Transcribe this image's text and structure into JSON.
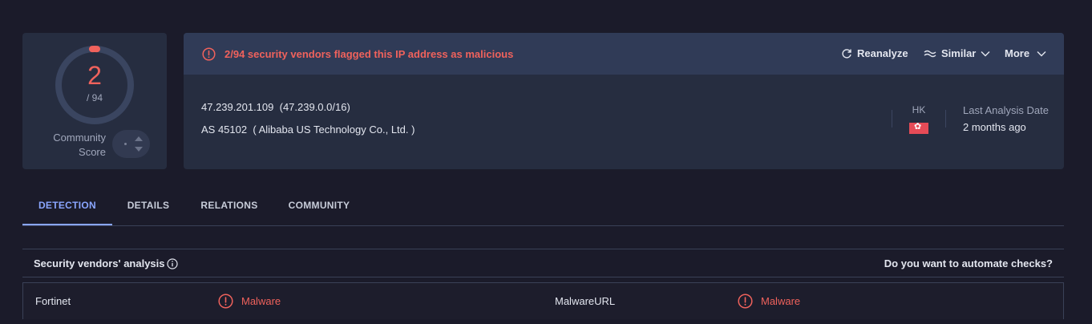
{
  "score": {
    "detections": "2",
    "total": "/ 94",
    "community_label_line1": "Community",
    "community_label_line2": "Score",
    "detection_fraction": 0.0213
  },
  "alert": {
    "text": "2/94 security vendors flagged this IP address as malicious"
  },
  "actions": {
    "reanalyze": "Reanalyze",
    "similar": "Similar",
    "more": "More"
  },
  "ip_info": {
    "ip": "47.239.201.109",
    "range": "(47.239.0.0/16)",
    "as": "AS 45102",
    "org": "( Alibaba US Technology Co., Ltd. )"
  },
  "country": {
    "code": "HK",
    "flag_color": "#e64b57"
  },
  "last_analysis": {
    "label": "Last Analysis Date",
    "value": "2 months ago"
  },
  "tabs": [
    {
      "label": "DETECTION"
    },
    {
      "label": "DETAILS"
    },
    {
      "label": "RELATIONS"
    },
    {
      "label": "COMMUNITY"
    }
  ],
  "vendors_section": {
    "title": "Security vendors' analysis",
    "automate": "Do you want to automate checks?"
  },
  "results": [
    {
      "vendor": "Fortinet",
      "verdict": "Malware"
    },
    {
      "vendor": "MalwareURL",
      "verdict": "Malware"
    }
  ],
  "colors": {
    "malicious": "#f0625c",
    "accent": "#8aa6ff",
    "card": "#262d40",
    "alert_bar": "#303b57"
  }
}
